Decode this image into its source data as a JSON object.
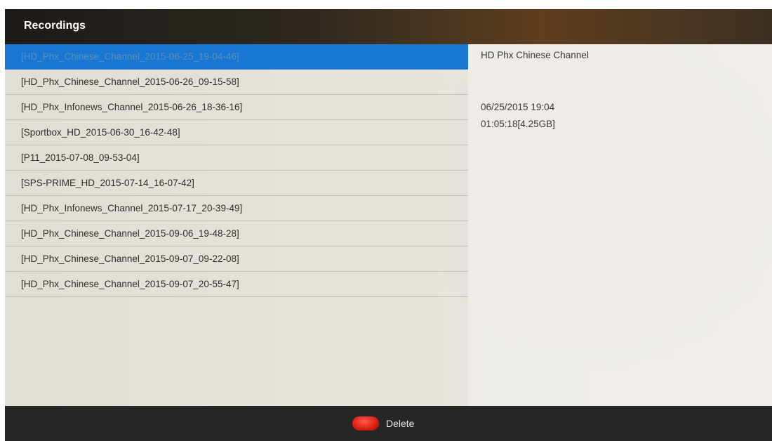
{
  "header": {
    "title": "Recordings"
  },
  "recordings": [
    "[HD_Phx_Chinese_Channel_2015-06-25_19-04-46]",
    "[HD_Phx_Chinese_Channel_2015-06-26_09-15-58]",
    "[HD_Phx_Infonews_Channel_2015-06-26_18-36-16]",
    "[Sportbox_HD_2015-06-30_16-42-48]",
    "[P11_2015-07-08_09-53-04]",
    "[SPS-PRIME_HD_2015-07-14_16-07-42]",
    "[HD_Phx_Infonews_Channel_2015-07-17_20-39-49]",
    "[HD_Phx_Chinese_Channel_2015-09-06_19-48-28]",
    "[HD_Phx_Chinese_Channel_2015-09-07_09-22-08]",
    "[HD_Phx_Chinese_Channel_2015-09-07_20-55-47]"
  ],
  "selected_index": 0,
  "details": {
    "channel": "HD Phx Chinese Channel",
    "datetime": "06/25/2015 19:04",
    "duration_size": "01:05:18[4.25GB]"
  },
  "footer": {
    "delete_label": "Delete",
    "delete_icon": "red-button-icon",
    "delete_color": "#e0261a"
  },
  "colors": {
    "selection": "#1976d2",
    "header_text": "#ffffff"
  }
}
